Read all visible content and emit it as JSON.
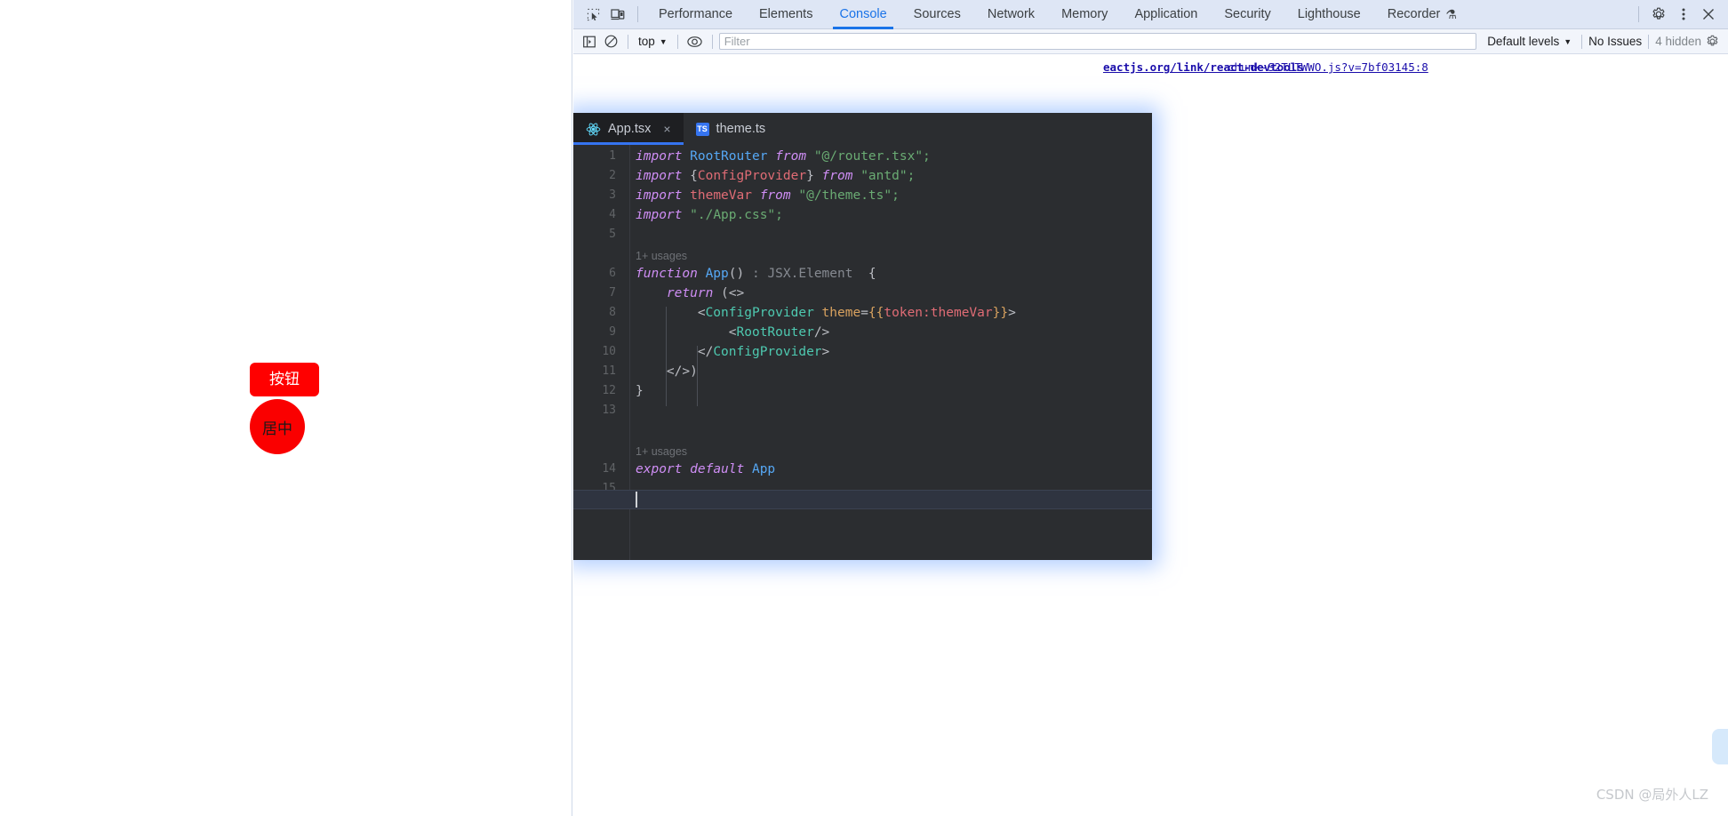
{
  "page": {
    "button": {
      "label": "按钮",
      "bg": "#ff0000",
      "color": "#ffffff"
    },
    "circle": {
      "label": "居中",
      "bg": "#fa0000",
      "color": "#1a1a1a"
    }
  },
  "devtools": {
    "toolbar": {
      "inspect_icon": "inspect-element-icon",
      "device_icon": "device-toolbar-icon",
      "tabs": [
        {
          "label": "Performance",
          "active": false
        },
        {
          "label": "Elements",
          "active": false
        },
        {
          "label": "Console",
          "active": true
        },
        {
          "label": "Sources",
          "active": false
        },
        {
          "label": "Network",
          "active": false
        },
        {
          "label": "Memory",
          "active": false
        },
        {
          "label": "Application",
          "active": false
        },
        {
          "label": "Security",
          "active": false
        },
        {
          "label": "Lighthouse",
          "active": false
        },
        {
          "label": "Recorder",
          "active": false,
          "badge": "⚗"
        }
      ],
      "settings_icon": "gear-icon",
      "more_icon": "kebab-menu-icon",
      "close_icon": "close-icon",
      "accent_color": "#1a73e8"
    },
    "console_filter_bar": {
      "sidebar_toggle_icon": "console-sidebar-icon",
      "clear_icon": "clear-console-icon",
      "context_selector": "top",
      "eye_icon": "live-expression-icon",
      "filter_placeholder": "Filter",
      "filter_value": "",
      "levels_selector": "Default levels",
      "issues_label": "No Issues",
      "hidden_label": "4 hidden",
      "settings_icon": "console-settings-icon"
    },
    "console_messages": [
      {
        "text": "eactjs.org/link/react-devtools",
        "type": "link"
      },
      {
        "text": "chunk-S2TLTWWO.js?v=7bf03145:8",
        "type": "source-link"
      }
    ]
  },
  "editor": {
    "tabs": [
      {
        "label": "App.tsx",
        "icon": "react-icon",
        "active": true,
        "closable": true
      },
      {
        "label": "theme.ts",
        "icon": "typescript-icon",
        "active": false,
        "closable": false
      }
    ],
    "ts_badge": "TS",
    "close_glyph": "×",
    "usage_hint_1": "1+ usages",
    "usage_hint_2": "1+ usages",
    "gutter": [
      "1",
      "2",
      "3",
      "4",
      "5",
      "6",
      "7",
      "8",
      "9",
      "10",
      "11",
      "12",
      "13",
      "14",
      "15"
    ],
    "lines": [
      {
        "n": "1",
        "tokens": [
          {
            "t": "import",
            "c": "t-kw"
          },
          {
            "t": " ",
            "c": "t-punct"
          },
          {
            "t": "RootRouter",
            "c": "t-ident"
          },
          {
            "t": " ",
            "c": "t-punct"
          },
          {
            "t": "from",
            "c": "t-kw"
          },
          {
            "t": " ",
            "c": "t-punct"
          },
          {
            "t": "\"@/router.tsx\";",
            "c": "t-str"
          }
        ]
      },
      {
        "n": "2",
        "tokens": [
          {
            "t": "import",
            "c": "t-kw"
          },
          {
            "t": " {",
            "c": "t-punct"
          },
          {
            "t": "ConfigProvider",
            "c": "t-cls"
          },
          {
            "t": "} ",
            "c": "t-punct"
          },
          {
            "t": "from",
            "c": "t-kw"
          },
          {
            "t": " ",
            "c": "t-punct"
          },
          {
            "t": "\"antd\";",
            "c": "t-str"
          }
        ]
      },
      {
        "n": "3",
        "tokens": [
          {
            "t": "import",
            "c": "t-kw"
          },
          {
            "t": " ",
            "c": "t-punct"
          },
          {
            "t": "themeVar",
            "c": "t-cls"
          },
          {
            "t": " ",
            "c": "t-punct"
          },
          {
            "t": "from",
            "c": "t-kw"
          },
          {
            "t": " ",
            "c": "t-punct"
          },
          {
            "t": "\"@/theme.ts\";",
            "c": "t-str"
          }
        ]
      },
      {
        "n": "4",
        "tokens": [
          {
            "t": "import",
            "c": "t-kw"
          },
          {
            "t": " ",
            "c": "t-punct"
          },
          {
            "t": "\"./App.css\";",
            "c": "t-str"
          }
        ]
      },
      {
        "n": "5",
        "tokens": []
      },
      {
        "n": "6",
        "tokens": [
          {
            "t": "function",
            "c": "t-kw"
          },
          {
            "t": " ",
            "c": "t-punct"
          },
          {
            "t": "App",
            "c": "t-ident"
          },
          {
            "t": "()",
            "c": "t-punct"
          },
          {
            "t": " : JSX.Element ",
            "c": "t-type"
          },
          {
            "t": " {",
            "c": "t-punct"
          }
        ]
      },
      {
        "n": "7",
        "tokens": [
          {
            "t": "    ",
            "c": "t-punct"
          },
          {
            "t": "return",
            "c": "t-kw"
          },
          {
            "t": " (<>",
            "c": "t-punct"
          }
        ]
      },
      {
        "n": "8",
        "tokens": [
          {
            "t": "        <",
            "c": "t-punct"
          },
          {
            "t": "ConfigProvider",
            "c": "t-tag"
          },
          {
            "t": " ",
            "c": "t-punct"
          },
          {
            "t": "theme",
            "c": "t-attr"
          },
          {
            "t": "=",
            "c": "t-punct"
          },
          {
            "t": "{{",
            "c": "t-brace"
          },
          {
            "t": "token:themeVar",
            "c": "t-cls"
          },
          {
            "t": "}}",
            "c": "t-brace"
          },
          {
            "t": ">",
            "c": "t-punct"
          }
        ]
      },
      {
        "n": "9",
        "tokens": [
          {
            "t": "            <",
            "c": "t-punct"
          },
          {
            "t": "RootRouter",
            "c": "t-tag"
          },
          {
            "t": "/>",
            "c": "t-punct"
          }
        ]
      },
      {
        "n": "10",
        "tokens": [
          {
            "t": "        </",
            "c": "t-punct"
          },
          {
            "t": "ConfigProvider",
            "c": "t-tag"
          },
          {
            "t": ">",
            "c": "t-punct"
          }
        ]
      },
      {
        "n": "11",
        "tokens": [
          {
            "t": "    </>)",
            "c": "t-punct"
          }
        ]
      },
      {
        "n": "12",
        "tokens": [
          {
            "t": "}",
            "c": "t-punct"
          }
        ]
      },
      {
        "n": "13",
        "tokens": []
      },
      {
        "n": "14",
        "tokens": [
          {
            "t": "export",
            "c": "t-kw"
          },
          {
            "t": " ",
            "c": "t-punct"
          },
          {
            "t": "default",
            "c": "t-kw"
          },
          {
            "t": " ",
            "c": "t-punct"
          },
          {
            "t": "App",
            "c": "t-ident"
          }
        ]
      },
      {
        "n": "15",
        "tokens": []
      }
    ]
  },
  "watermark": "CSDN @局外人LZ"
}
